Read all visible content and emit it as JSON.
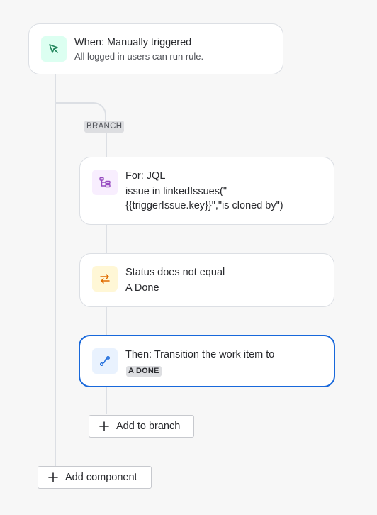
{
  "trigger": {
    "title": "When: Manually triggered",
    "subtitle": "All logged in users can run rule.",
    "icon": "cursor-arrow-icon",
    "icon_bg": "#dcfff1",
    "icon_color": "#1f845a"
  },
  "branch": {
    "label": "BRANCH",
    "for_card": {
      "title": "For: JQL",
      "line1": "issue in linkedIssues(\"",
      "line2": "{{triggerIssue.key}}\",\"is cloned by\")",
      "icon": "branch-hierarchy-icon",
      "icon_bg": "#f8eefe",
      "icon_color": "#964ac0"
    },
    "condition_card": {
      "title": "Status does not equal",
      "value": "A Done",
      "icon": "swap-arrows-icon",
      "icon_bg": "#fff7d6",
      "icon_color": "#e06c00"
    },
    "action_card": {
      "title": "Then: Transition the work item to",
      "status": "A DONE",
      "icon": "transition-path-icon",
      "icon_bg": "#e9f2fe",
      "icon_color": "#1868db",
      "selected": true
    },
    "add_button": "Add to branch"
  },
  "add_component_button": "Add component",
  "colors": {
    "connector": "#dcdfe4",
    "selected_border": "#1868db",
    "background": "#f7f7f7"
  }
}
